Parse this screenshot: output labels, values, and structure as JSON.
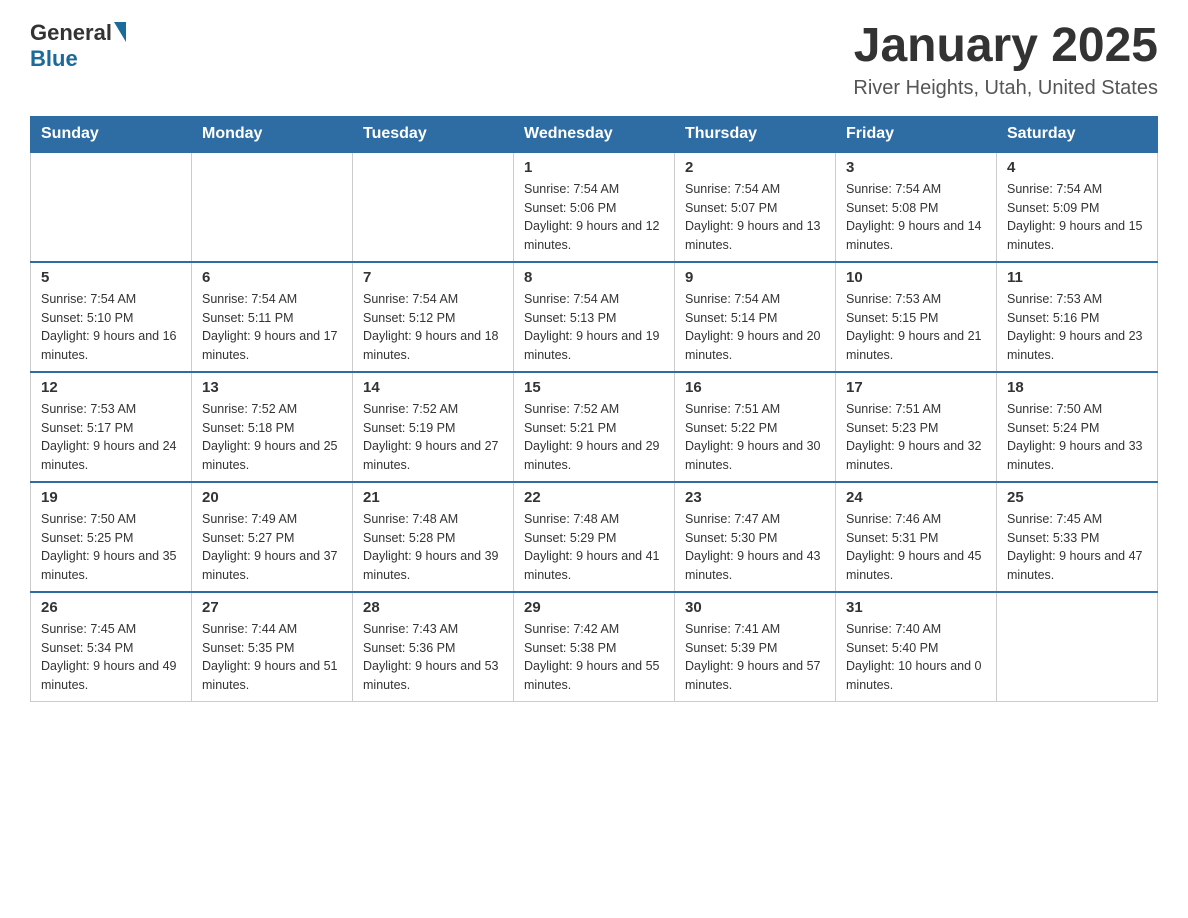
{
  "header": {
    "logo_general": "General",
    "logo_blue": "Blue",
    "title": "January 2025",
    "location": "River Heights, Utah, United States"
  },
  "days_of_week": [
    "Sunday",
    "Monday",
    "Tuesday",
    "Wednesday",
    "Thursday",
    "Friday",
    "Saturday"
  ],
  "weeks": [
    [
      {
        "day": "",
        "sunrise": "",
        "sunset": "",
        "daylight": ""
      },
      {
        "day": "",
        "sunrise": "",
        "sunset": "",
        "daylight": ""
      },
      {
        "day": "",
        "sunrise": "",
        "sunset": "",
        "daylight": ""
      },
      {
        "day": "1",
        "sunrise": "Sunrise: 7:54 AM",
        "sunset": "Sunset: 5:06 PM",
        "daylight": "Daylight: 9 hours and 12 minutes."
      },
      {
        "day": "2",
        "sunrise": "Sunrise: 7:54 AM",
        "sunset": "Sunset: 5:07 PM",
        "daylight": "Daylight: 9 hours and 13 minutes."
      },
      {
        "day": "3",
        "sunrise": "Sunrise: 7:54 AM",
        "sunset": "Sunset: 5:08 PM",
        "daylight": "Daylight: 9 hours and 14 minutes."
      },
      {
        "day": "4",
        "sunrise": "Sunrise: 7:54 AM",
        "sunset": "Sunset: 5:09 PM",
        "daylight": "Daylight: 9 hours and 15 minutes."
      }
    ],
    [
      {
        "day": "5",
        "sunrise": "Sunrise: 7:54 AM",
        "sunset": "Sunset: 5:10 PM",
        "daylight": "Daylight: 9 hours and 16 minutes."
      },
      {
        "day": "6",
        "sunrise": "Sunrise: 7:54 AM",
        "sunset": "Sunset: 5:11 PM",
        "daylight": "Daylight: 9 hours and 17 minutes."
      },
      {
        "day": "7",
        "sunrise": "Sunrise: 7:54 AM",
        "sunset": "Sunset: 5:12 PM",
        "daylight": "Daylight: 9 hours and 18 minutes."
      },
      {
        "day": "8",
        "sunrise": "Sunrise: 7:54 AM",
        "sunset": "Sunset: 5:13 PM",
        "daylight": "Daylight: 9 hours and 19 minutes."
      },
      {
        "day": "9",
        "sunrise": "Sunrise: 7:54 AM",
        "sunset": "Sunset: 5:14 PM",
        "daylight": "Daylight: 9 hours and 20 minutes."
      },
      {
        "day": "10",
        "sunrise": "Sunrise: 7:53 AM",
        "sunset": "Sunset: 5:15 PM",
        "daylight": "Daylight: 9 hours and 21 minutes."
      },
      {
        "day": "11",
        "sunrise": "Sunrise: 7:53 AM",
        "sunset": "Sunset: 5:16 PM",
        "daylight": "Daylight: 9 hours and 23 minutes."
      }
    ],
    [
      {
        "day": "12",
        "sunrise": "Sunrise: 7:53 AM",
        "sunset": "Sunset: 5:17 PM",
        "daylight": "Daylight: 9 hours and 24 minutes."
      },
      {
        "day": "13",
        "sunrise": "Sunrise: 7:52 AM",
        "sunset": "Sunset: 5:18 PM",
        "daylight": "Daylight: 9 hours and 25 minutes."
      },
      {
        "day": "14",
        "sunrise": "Sunrise: 7:52 AM",
        "sunset": "Sunset: 5:19 PM",
        "daylight": "Daylight: 9 hours and 27 minutes."
      },
      {
        "day": "15",
        "sunrise": "Sunrise: 7:52 AM",
        "sunset": "Sunset: 5:21 PM",
        "daylight": "Daylight: 9 hours and 29 minutes."
      },
      {
        "day": "16",
        "sunrise": "Sunrise: 7:51 AM",
        "sunset": "Sunset: 5:22 PM",
        "daylight": "Daylight: 9 hours and 30 minutes."
      },
      {
        "day": "17",
        "sunrise": "Sunrise: 7:51 AM",
        "sunset": "Sunset: 5:23 PM",
        "daylight": "Daylight: 9 hours and 32 minutes."
      },
      {
        "day": "18",
        "sunrise": "Sunrise: 7:50 AM",
        "sunset": "Sunset: 5:24 PM",
        "daylight": "Daylight: 9 hours and 33 minutes."
      }
    ],
    [
      {
        "day": "19",
        "sunrise": "Sunrise: 7:50 AM",
        "sunset": "Sunset: 5:25 PM",
        "daylight": "Daylight: 9 hours and 35 minutes."
      },
      {
        "day": "20",
        "sunrise": "Sunrise: 7:49 AM",
        "sunset": "Sunset: 5:27 PM",
        "daylight": "Daylight: 9 hours and 37 minutes."
      },
      {
        "day": "21",
        "sunrise": "Sunrise: 7:48 AM",
        "sunset": "Sunset: 5:28 PM",
        "daylight": "Daylight: 9 hours and 39 minutes."
      },
      {
        "day": "22",
        "sunrise": "Sunrise: 7:48 AM",
        "sunset": "Sunset: 5:29 PM",
        "daylight": "Daylight: 9 hours and 41 minutes."
      },
      {
        "day": "23",
        "sunrise": "Sunrise: 7:47 AM",
        "sunset": "Sunset: 5:30 PM",
        "daylight": "Daylight: 9 hours and 43 minutes."
      },
      {
        "day": "24",
        "sunrise": "Sunrise: 7:46 AM",
        "sunset": "Sunset: 5:31 PM",
        "daylight": "Daylight: 9 hours and 45 minutes."
      },
      {
        "day": "25",
        "sunrise": "Sunrise: 7:45 AM",
        "sunset": "Sunset: 5:33 PM",
        "daylight": "Daylight: 9 hours and 47 minutes."
      }
    ],
    [
      {
        "day": "26",
        "sunrise": "Sunrise: 7:45 AM",
        "sunset": "Sunset: 5:34 PM",
        "daylight": "Daylight: 9 hours and 49 minutes."
      },
      {
        "day": "27",
        "sunrise": "Sunrise: 7:44 AM",
        "sunset": "Sunset: 5:35 PM",
        "daylight": "Daylight: 9 hours and 51 minutes."
      },
      {
        "day": "28",
        "sunrise": "Sunrise: 7:43 AM",
        "sunset": "Sunset: 5:36 PM",
        "daylight": "Daylight: 9 hours and 53 minutes."
      },
      {
        "day": "29",
        "sunrise": "Sunrise: 7:42 AM",
        "sunset": "Sunset: 5:38 PM",
        "daylight": "Daylight: 9 hours and 55 minutes."
      },
      {
        "day": "30",
        "sunrise": "Sunrise: 7:41 AM",
        "sunset": "Sunset: 5:39 PM",
        "daylight": "Daylight: 9 hours and 57 minutes."
      },
      {
        "day": "31",
        "sunrise": "Sunrise: 7:40 AM",
        "sunset": "Sunset: 5:40 PM",
        "daylight": "Daylight: 10 hours and 0 minutes."
      },
      {
        "day": "",
        "sunrise": "",
        "sunset": "",
        "daylight": ""
      }
    ]
  ]
}
